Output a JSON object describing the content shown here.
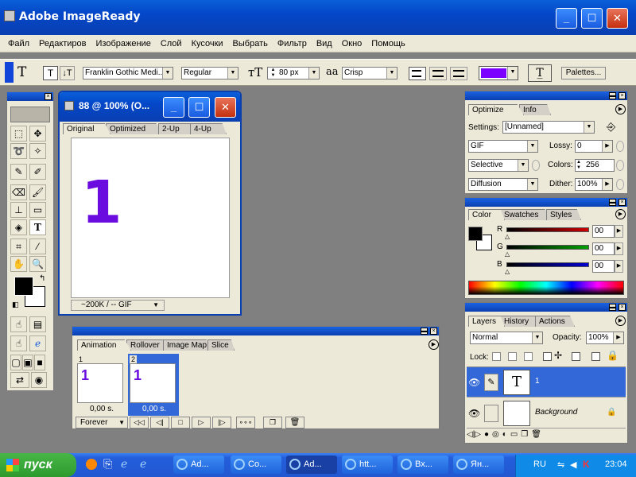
{
  "app": {
    "title": "Adobe ImageReady"
  },
  "menu": [
    "Файл",
    "Редактиров",
    "Изображение",
    "Слой",
    "Кусочки",
    "Выбрать",
    "Фильтр",
    "Вид",
    "Окно",
    "Помощь"
  ],
  "options_bar": {
    "tool_glyph": "T",
    "font_family": "Franklin Gothic Medi...",
    "font_style": "Regular",
    "font_size": "80 px",
    "aa_glyph": "a",
    "antialias": "Crisp",
    "palettes_button": "Palettes...",
    "text_color": "#7b00ff"
  },
  "doc": {
    "title": "88 @ 100% (O...",
    "tabs": [
      "Original",
      "Optimized",
      "2-Up",
      "4-Up"
    ],
    "canvas_text": "1",
    "canvas_text_color": "#6a0be0",
    "status": "~200K / -- GIF"
  },
  "optimize": {
    "tabs": [
      "Optimize",
      "Info"
    ],
    "settings_label": "Settings:",
    "settings_value": "[Unnamed]",
    "format": "GIF",
    "lossy_label": "Lossy:",
    "lossy_value": "0",
    "palette": "Selective",
    "colors_label": "Colors:",
    "colors_value": "256",
    "dither_algo": "Diffusion",
    "dither_label": "Dither:",
    "dither_value": "100%"
  },
  "color": {
    "tabs": [
      "Color",
      "Swatches",
      "Styles"
    ],
    "channels": [
      {
        "name": "R",
        "value": "00",
        "color": "#d00000"
      },
      {
        "name": "G",
        "value": "00",
        "color": "#00a000"
      },
      {
        "name": "B",
        "value": "00",
        "color": "#0000d0"
      }
    ]
  },
  "layers": {
    "tabs": [
      "Layers",
      "History",
      "Actions"
    ],
    "blend_mode": "Normal",
    "opacity_label": "Opacity:",
    "opacity_value": "100%",
    "lock_label": "Lock:",
    "items": [
      {
        "name": "1",
        "thumb": "T",
        "selected": true
      },
      {
        "name": "Background",
        "thumb": "",
        "selected": false
      }
    ]
  },
  "animation": {
    "tabs": [
      "Animation",
      "Rollover",
      "Image Map",
      "Slice"
    ],
    "frames": [
      {
        "index": "1",
        "text": "1",
        "delay": "0,00 s.",
        "selected": false
      },
      {
        "index": "2",
        "text": "1",
        "delay": "0,00 s.",
        "selected": true
      }
    ],
    "loop": "Forever"
  },
  "taskbar": {
    "start": "пуск",
    "buttons": [
      "Ad...",
      "Co...",
      "Ad...",
      "htt...",
      "Вх...",
      "Ян..."
    ],
    "lang": "RU",
    "time": "23:04"
  }
}
